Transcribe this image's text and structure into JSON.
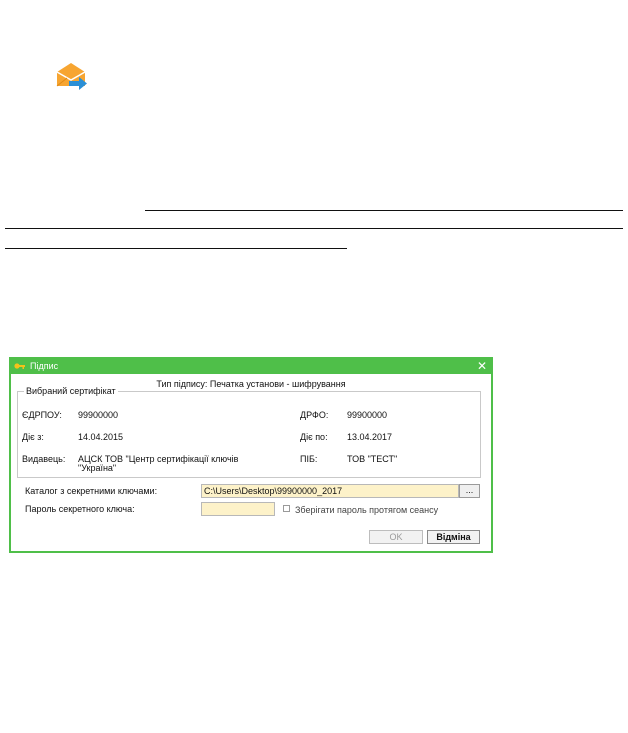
{
  "dialog": {
    "title": "Підпис",
    "close_glyph": "✕",
    "signature_type": "Тип підпису: Печатка установи - шифрування",
    "certificate_legend": "Вибраний сертифікат",
    "certificate": {
      "edrpou_label": "ЄДРПОУ:",
      "edrpou_value": "99900000",
      "drfo_label": "ДРФО:",
      "drfo_value": "99900000",
      "valid_from_label": "Діє з:",
      "valid_from_value": "14.04.2015",
      "valid_to_label": "Діє по:",
      "valid_to_value": "13.04.2017",
      "issuer_label": "Видавець:",
      "issuer_value_line1": "АЦСК ТОВ \"Центр сертифікації ключів",
      "issuer_value_line2": "\"Україна\"",
      "name_label": "ПІБ:",
      "name_value": "ТОВ \"ТЕСТ\""
    },
    "keys_dir_label": "Каталог з секретними ключами:",
    "keys_dir_value": "C:\\Users\\Desktop\\99900000_2017",
    "browse_label": "...",
    "password_label": "Пароль секретного ключа:",
    "password_value": "",
    "remember_label": "Зберігати пароль протягом сеансу",
    "ok_label": "OK",
    "cancel_label": "Відміна"
  },
  "icons": {
    "app_icon": "envelope-arrow-icon",
    "title_icon": "key-icon"
  },
  "colors": {
    "accent": "#4fbf49",
    "input_bg": "#fdf2c9",
    "envelope": "#f7a531",
    "arrow": "#2a8fd6"
  }
}
